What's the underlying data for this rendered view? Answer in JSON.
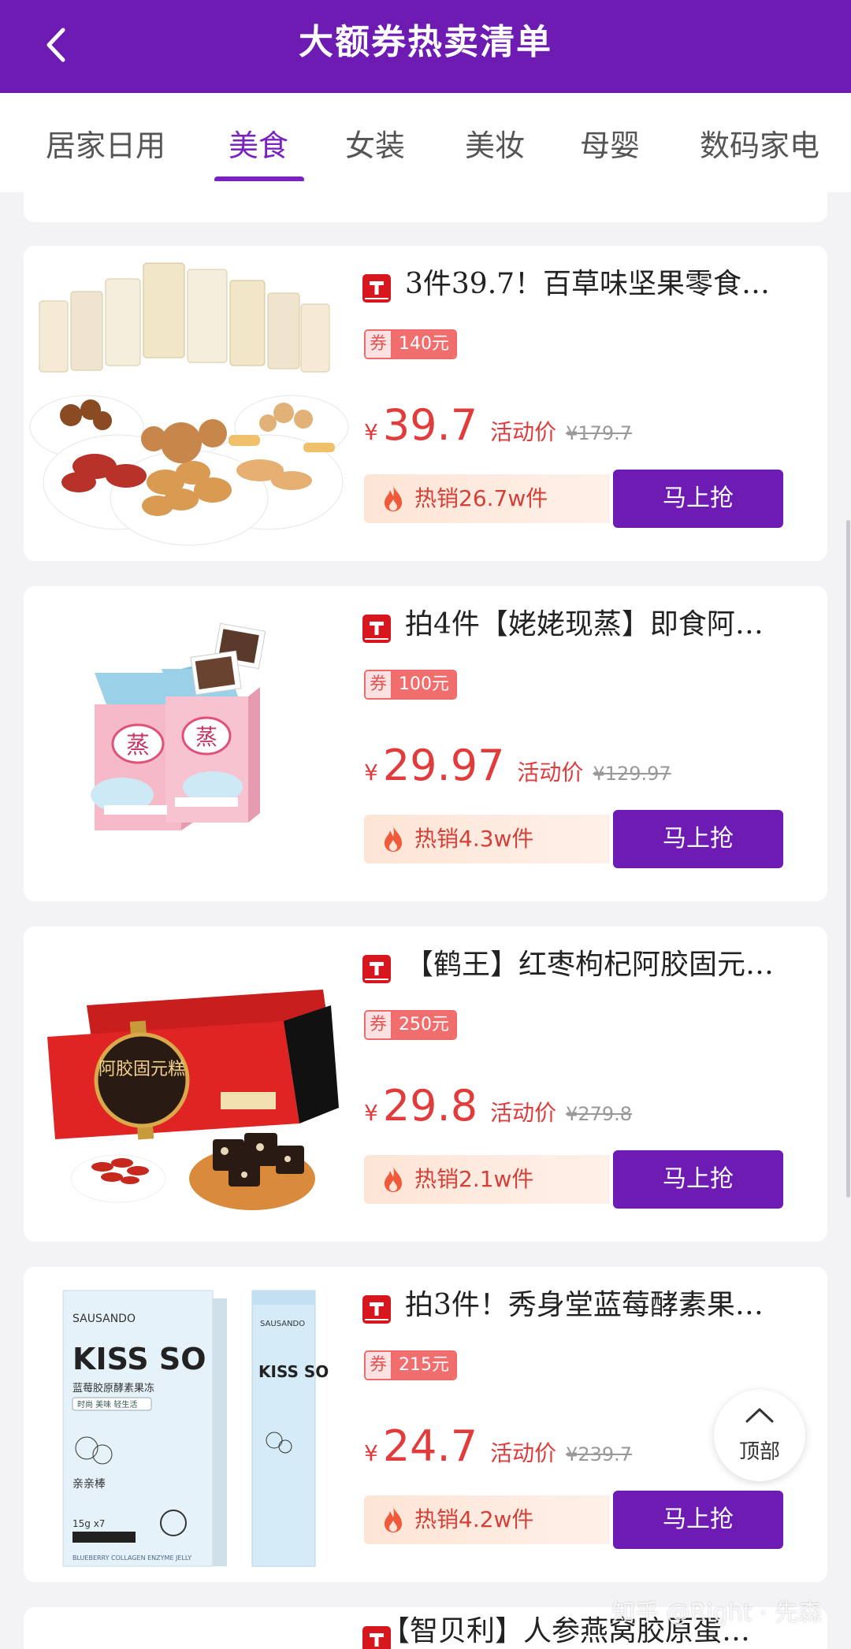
{
  "header": {
    "title": "大额券热卖清单"
  },
  "tabs": [
    "居家日用",
    "美食",
    "女装",
    "美妆",
    "母婴",
    "数码家电"
  ],
  "active_tab": "美食",
  "colors": {
    "brand": "#6e1bb3",
    "price": "#e13b3b",
    "coupon": "#f06e6e"
  },
  "products": [
    {
      "title": "3件39.7！百草味坚果零食…",
      "coupon_tag": "券",
      "coupon": "140元",
      "currency": "¥",
      "price": "39.7",
      "activity_label": "活动价",
      "original_price": "¥179.7",
      "hot": "热销26.7w件",
      "buy_label": "马上抢"
    },
    {
      "title": "拍4件【姥姥现蒸】即食阿…",
      "coupon_tag": "券",
      "coupon": "100元",
      "currency": "¥",
      "price": "29.97",
      "activity_label": "活动价",
      "original_price": "¥129.97",
      "hot": "热销4.3w件",
      "buy_label": "马上抢"
    },
    {
      "title": "【鹤王】红枣枸杞阿胶固元…",
      "coupon_tag": "券",
      "coupon": "250元",
      "currency": "¥",
      "price": "29.8",
      "activity_label": "活动价",
      "original_price": "¥279.8",
      "hot": "热销2.1w件",
      "buy_label": "马上抢"
    },
    {
      "title": "拍3件！秀身堂蓝莓酵素果…",
      "coupon_tag": "券",
      "coupon": "215元",
      "currency": "¥",
      "price": "24.7",
      "activity_label": "活动价",
      "original_price": "¥239.7",
      "hot": "热销4.2w件",
      "buy_label": "马上抢"
    }
  ],
  "partial_product": {
    "title": "【智贝利】人参燕窝胶原蛋…"
  },
  "thumb_text": {
    "box2_char": "蒸",
    "box3_text": "阿胶固元糕",
    "box4_brand": "SAUSANDO",
    "box4_name": "KISS SO",
    "box4_cn": "蓝莓胶原酵素果冻",
    "box4_tag": "时尚 美味 轻生活",
    "box4_sub": "亲亲棒",
    "box4_weight": "15g x7",
    "box4_footer": "BLUEBERRY COLLAGEN ENZYME JELLY"
  },
  "top_button": {
    "label": "顶部"
  },
  "watermark": "知乎 @Right · 先森"
}
